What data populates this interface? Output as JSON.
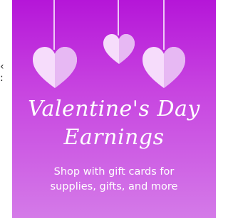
{
  "side_text": "‹\n:",
  "banner": {
    "title_line1": "Valentine's Day",
    "title_line2": "Earnings",
    "subtitle_line1": "Shop with gift cards for",
    "subtitle_line2": "supplies, gifts, and more",
    "icons": [
      "heart-icon",
      "heart-icon",
      "heart-icon"
    ],
    "colors": {
      "background_top": "#b516d8",
      "background_bottom": "#d47ae8",
      "heart_light": "#f6dcfb",
      "heart_shade": "#e7b8f3",
      "text": "#ffffff"
    }
  }
}
